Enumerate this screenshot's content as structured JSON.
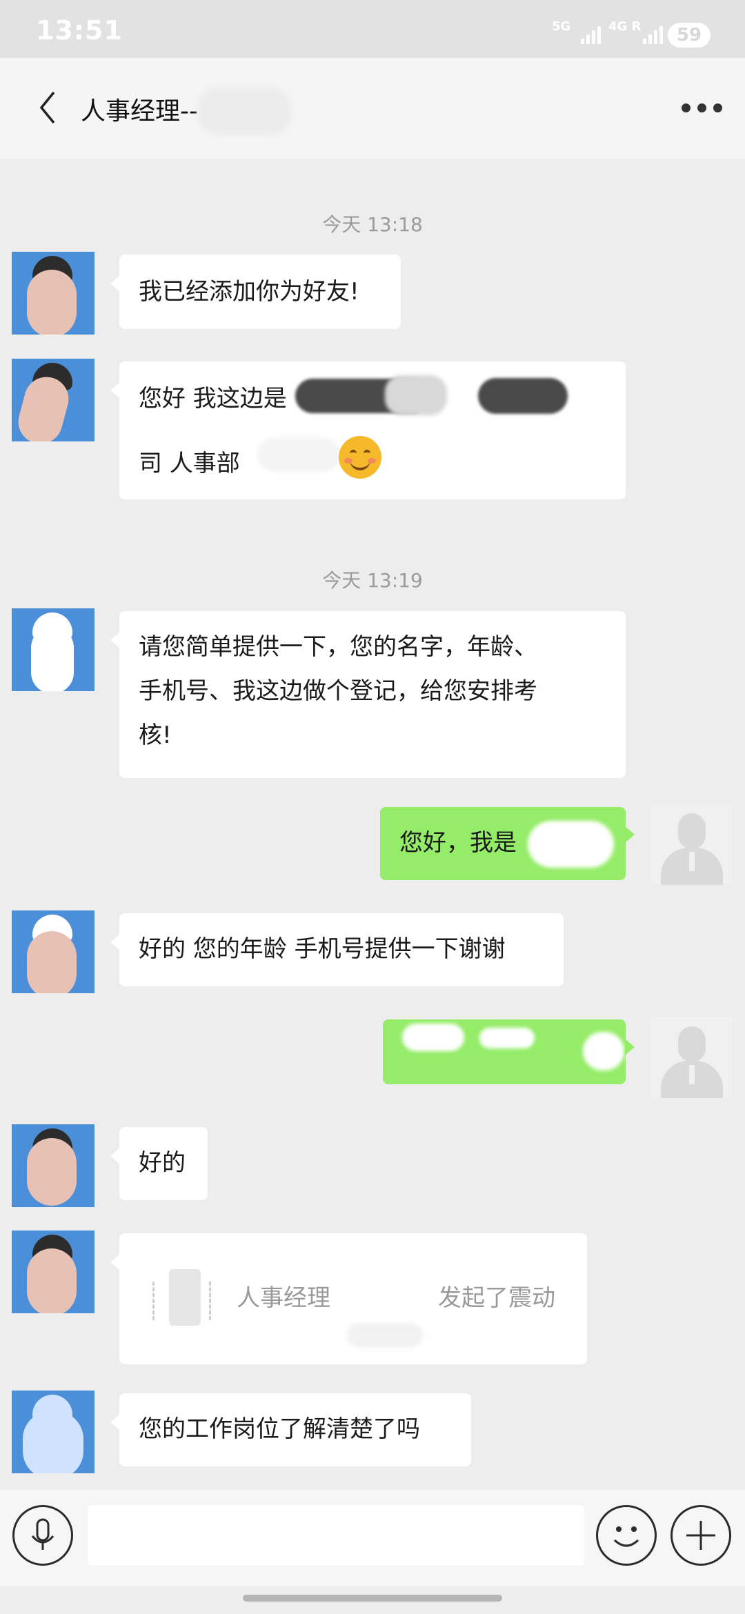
{
  "status_bar": {
    "time": "13:51",
    "net1": "5G",
    "net2": "4G R",
    "battery": "59"
  },
  "header": {
    "title": "人事经理--"
  },
  "messages": {
    "ts1": "今天 13:18",
    "m1": "我已经添加你为好友!",
    "m2_line1": "您好 我这边是",
    "m2_line2": "司 人事部",
    "ts2": "今天 13:19",
    "m3_line1": "请您简单提供一下，您的名字，年龄、",
    "m3_line2": "手机号、我这边做个登记，给您安排考",
    "m3_line3": "核!",
    "m4": "您好，我是",
    "m5": "好的 您的年龄 手机号提供一下谢谢",
    "m7": "好的",
    "m8_left": "人事经理",
    "m8_right": "发起了震动",
    "m9": "您的工作岗位了解清楚了吗"
  },
  "icons": {
    "back": "chevron-left-icon",
    "more": "more-dots-icon",
    "voice": "microphone-icon",
    "emoji": "smiley-icon",
    "plus": "plus-icon"
  },
  "colors": {
    "outgoing_bubble": "#95ec69",
    "background": "#ededed",
    "avatar_bg": "#4b8fd8"
  }
}
